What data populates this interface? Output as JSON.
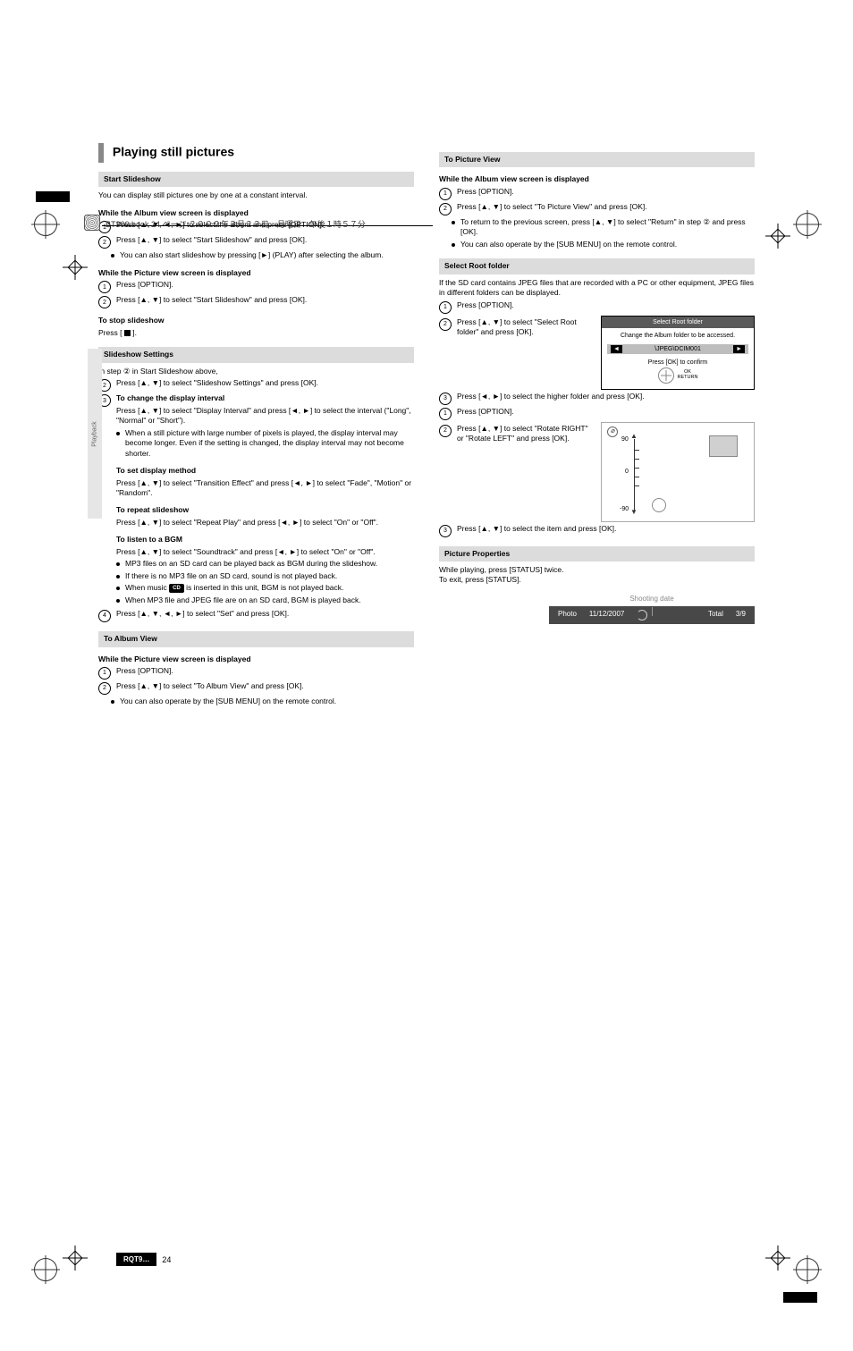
{
  "header": {
    "filename_line": "BT300.book  24 ページ  ２００９年３月２３日　月曜日　午後１時５７分"
  },
  "side_tab": "Playback",
  "page_heading": "Playing still pictures",
  "left": {
    "sec_start": "Start Slideshow",
    "start_desc": "You can display still pictures one by one at a constant interval.",
    "while_album": "While the Album view screen is displayed",
    "start_steps": [
      {
        "n": "1",
        "text": "Press [▲, ▼, ◄, ►] to select the album and press [OPTION]."
      },
      {
        "n": "2",
        "text": "Press [▲, ▼] to select \"Start Slideshow\" and press [OK]."
      }
    ],
    "start_bullets": [
      "You can also start slideshow by pressing [►] (PLAY) after selecting the album."
    ],
    "while_picture": "While the Picture view screen is displayed",
    "picture_steps": [
      {
        "n": "1",
        "text": "Press [OPTION]."
      },
      {
        "n": "2",
        "text": "Press [▲, ▼] to select \"Start Slideshow\" and press [OK]."
      }
    ],
    "stop_label": "To stop slideshow",
    "stop_text": "Press [",
    "stop_text2": "].",
    "sec_settings": "Slideshow Settings",
    "settings_intro": "In step ② in Start Slideshow above,",
    "settings_steps_2": "Press [▲, ▼] to select \"Slideshow Settings\" and press [OK].",
    "settings_steps_3_lead": "To change the display interval",
    "settings_3a": "Press [▲, ▼] to select \"Display Interval\" and press [◄, ►] to select the interval (\"Long\", \"Normal\" or \"Short\").",
    "settings_3a_bullet": "When a still picture with large number of pixels is played, the display interval may become longer. Even if the setting is changed, the display interval may not become shorter.",
    "settings_trans_h": "To set display method",
    "settings_trans": "Press [▲, ▼] to select \"Transition Effect\" and press [◄, ►] to select \"Fade\", \"Motion\" or \"Random\".",
    "settings_repeat_h": "To repeat slideshow",
    "settings_repeat": "Press [▲, ▼] to select \"Repeat Play\" and press [◄, ►] to select \"On\" or \"Off\".",
    "settings_audio_h": "To listen to a BGM",
    "settings_audio": "Press [▲, ▼] to select \"Soundtrack\" and press [◄, ►] to select \"On\" or \"Off\".",
    "audio_bullets": [
      "MP3 files on an SD card can be played back as BGM during the slideshow.",
      "If there is no MP3 file on an SD card, sound is not played back.",
      "When music ",
      " is inserted in this unit, BGM is not played back.",
      "When MP3 file and JPEG file are on an SD card, BGM is played back."
    ],
    "cd_badge": "CD",
    "settings_4": "Press [▲, ▼, ◄, ►] to select \"Set\" and press [OK].",
    "sec_toalbum": "To Album View",
    "toalbum_lead": "While the Picture view screen is displayed",
    "toalbum_1": "Press [OPTION].",
    "toalbum_2": "Press [▲, ▼] to select \"To Album View\" and press [OK].",
    "toalbum_bullet": "You can also operate by the [SUB MENU] on the remote control."
  },
  "right": {
    "sec_topic": "To Picture View",
    "topic_lead": "While the Album view screen is displayed",
    "topic_1": "Press [OPTION].",
    "topic_2": "Press [▲, ▼] to select \"To Picture View\" and press [OK].",
    "topic_b1": "To return to the previous screen, press [▲, ▼] to select \"Return\" in step ② and press [OK].",
    "topic_b2": "You can also operate by the [SUB MENU] on the remote control.",
    "sec_sel": "Select Root folder",
    "sel_desc": "If the SD card contains JPEG files that are recorded with a PC or other equipment, JPEG files in different folders can be displayed.",
    "sel_1": "Press [OPTION].",
    "sel_2": "Press [▲, ▼] to select \"Select Root folder\" and press [OK].",
    "fig_root_title": "Select Root folder",
    "fig_root_sub": "Change the Album folder to be accessed.",
    "fig_root_path": "\\JPEG\\DCIM001",
    "fig_root_confirm": "Press [OK] to confirm",
    "fig_root_ok": "OK",
    "fig_root_return": "RETURN",
    "sel_3": "Press [◄, ►] to select the higher folder and press [OK].",
    "rot_1": "Press [OPTION].",
    "rot_2": "Press [▲, ▼] to select \"Rotate RIGHT\" or \"Rotate LEFT\" and press [OK].",
    "rot_scale_90": "90",
    "rot_scale_0": "0",
    "rot_scale_n90": "-90",
    "rot_3": "Press [▲, ▼] to select the item and press [OK].",
    "sec_props": "Picture Properties",
    "props_lead": "While playing, press [STATUS] twice.",
    "props_exit": "To exit, press [STATUS].",
    "shooting_date": "Shooting date",
    "strip_photo": "Photo",
    "strip_date": "11/12/2007",
    "strip_total": "Total",
    "strip_count": "3/9"
  },
  "footer": {
    "label": "RQT9…",
    "page": "24"
  }
}
